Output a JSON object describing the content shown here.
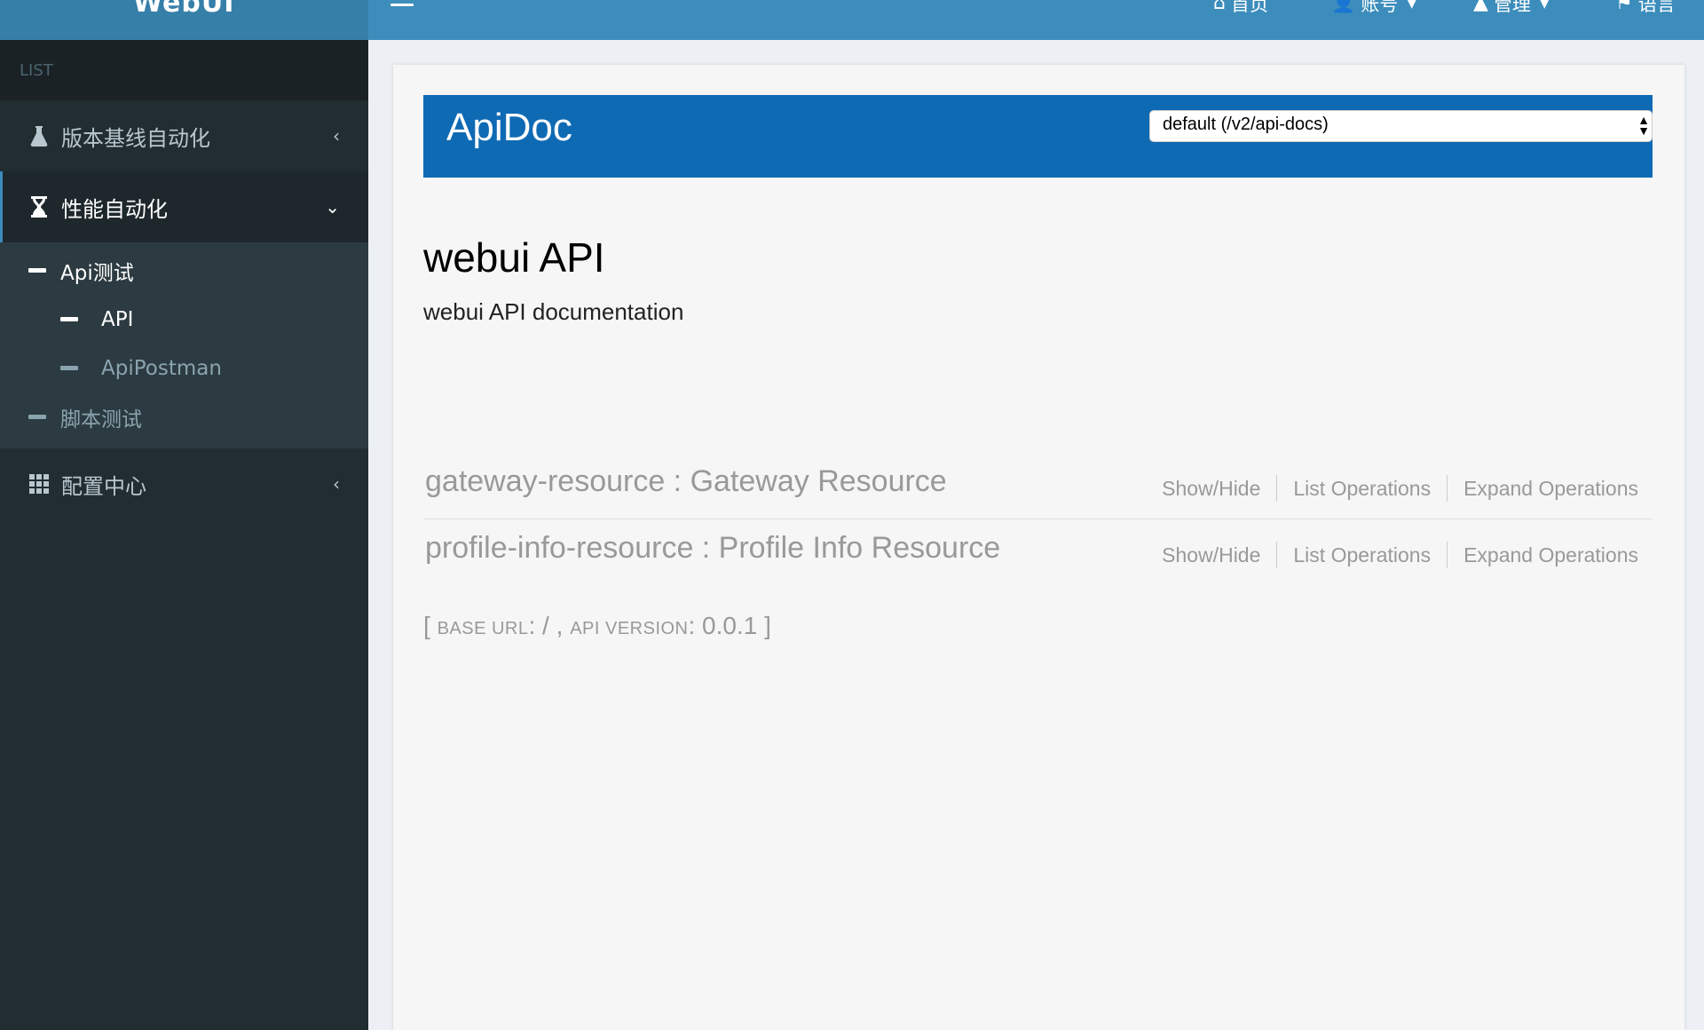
{
  "header": {
    "logo": "WebUI",
    "nav": [
      {
        "label": "首页",
        "icon": "home-icon"
      },
      {
        "label": "账号",
        "icon": "user-icon"
      },
      {
        "label": "管理",
        "icon": "admin-icon"
      },
      {
        "label": "语言",
        "icon": "flag-icon"
      }
    ]
  },
  "sidebar": {
    "section": "LIST",
    "items": [
      {
        "label": "版本基线自动化",
        "icon": "flask-icon"
      },
      {
        "label": "性能自动化",
        "icon": "hourglass-icon"
      },
      {
        "label": "配置中心",
        "icon": "grid-icon"
      }
    ],
    "submenu": {
      "api_test": "Api测试",
      "api": "API",
      "api_postman": "ApiPostman",
      "script_test": "脚本测试"
    }
  },
  "apidoc": {
    "title": "ApiDoc",
    "select_value": "default (/v2/api-docs)",
    "api_title": "webui API",
    "api_description": "webui API documentation",
    "resources": [
      {
        "name": "gateway-resource : Gateway Resource"
      },
      {
        "name": "profile-info-resource : Profile Info Resource"
      }
    ],
    "ops": {
      "show_hide": "Show/Hide",
      "list": "List Operations",
      "expand": "Expand Operations"
    },
    "base": {
      "open": "[ ",
      "base_label": "BASE URL",
      "base_value": ": / , ",
      "version_label": "API VERSION",
      "version_value": ": 0.0.1 ]"
    }
  },
  "colors": {
    "header": "#3c8dbc",
    "sidebar": "#222d32",
    "apidoc_bar": "#0f6ab4"
  }
}
